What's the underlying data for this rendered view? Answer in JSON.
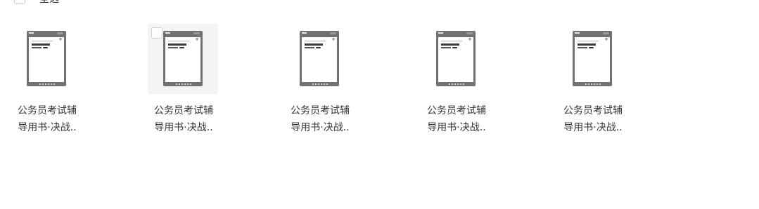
{
  "toolbar": {
    "select_all_label": "全选"
  },
  "files": [
    {
      "name_line1": "公务员考试辅",
      "name_line2": "导用书·决战..",
      "icon": "document-thumbnail",
      "hovered": false
    },
    {
      "name_line1": "公务员考试辅",
      "name_line2": "导用书·决战..",
      "icon": "document-thumbnail",
      "hovered": true
    },
    {
      "name_line1": "公务员考试辅",
      "name_line2": "导用书·决战..",
      "icon": "document-thumbnail",
      "hovered": false
    },
    {
      "name_line1": "公务员考试辅",
      "name_line2": "导用书·决战..",
      "icon": "document-thumbnail",
      "hovered": false
    },
    {
      "name_line1": "公务员考试辅",
      "name_line2": "导用书·决战..",
      "icon": "document-thumbnail",
      "hovered": false
    }
  ],
  "colors": {
    "hover_bg": "#f4f4f4",
    "thumb_frame": "#717171",
    "text": "#333333"
  }
}
